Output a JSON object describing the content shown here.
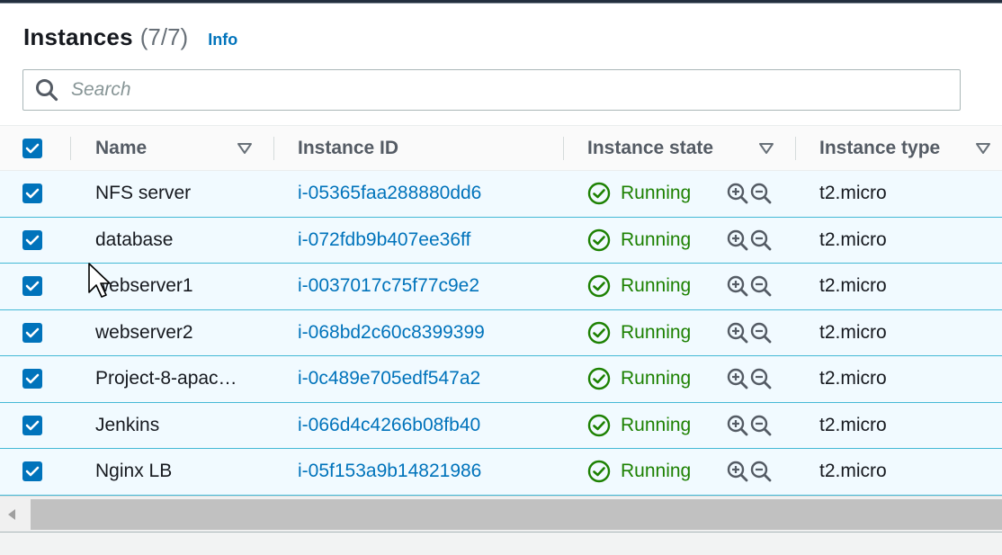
{
  "header": {
    "title": "Instances",
    "count": "(7/7)",
    "info_label": "Info"
  },
  "search": {
    "placeholder": "Search",
    "value": ""
  },
  "table": {
    "columns": {
      "name": "Name",
      "instance_id": "Instance ID",
      "instance_state": "Instance state",
      "instance_type": "Instance type"
    },
    "select_all_checked": true,
    "rows": [
      {
        "checked": true,
        "name": "NFS server",
        "instance_id": "i-05365faa288880dd6",
        "state": "Running",
        "type": "t2.micro"
      },
      {
        "checked": true,
        "name": "database",
        "instance_id": "i-072fdb9b407ee36ff",
        "state": "Running",
        "type": "t2.micro"
      },
      {
        "checked": true,
        "name": "webserver1",
        "instance_id": "i-0037017c75f77c9e2",
        "state": "Running",
        "type": "t2.micro"
      },
      {
        "checked": true,
        "name": "webserver2",
        "instance_id": "i-068bd2c60c8399399",
        "state": "Running",
        "type": "t2.micro"
      },
      {
        "checked": true,
        "name": "Project-8-apac…",
        "instance_id": "i-0c489e705edf547a2",
        "state": "Running",
        "type": "t2.micro"
      },
      {
        "checked": true,
        "name": "Jenkins",
        "instance_id": "i-066d4c4266b08fb40",
        "state": "Running",
        "type": "t2.micro"
      },
      {
        "checked": true,
        "name": "Nginx LB",
        "instance_id": "i-05f153a9b14821986",
        "state": "Running",
        "type": "t2.micro"
      }
    ]
  },
  "colors": {
    "link": "#0073bb",
    "running": "#1d8102",
    "selected_row_bg": "#f1faff",
    "selected_row_border": "#44b9d6"
  },
  "icons": {
    "search": "search-icon",
    "sort": "sort-caret-icon",
    "status": "check-circle-icon",
    "zoom_in": "zoom-in-icon",
    "zoom_out": "zoom-out-icon",
    "checkbox": "checkbox-checked-icon",
    "scroll_left": "scroll-left-arrow-icon",
    "cursor": "mouse-cursor-icon"
  }
}
